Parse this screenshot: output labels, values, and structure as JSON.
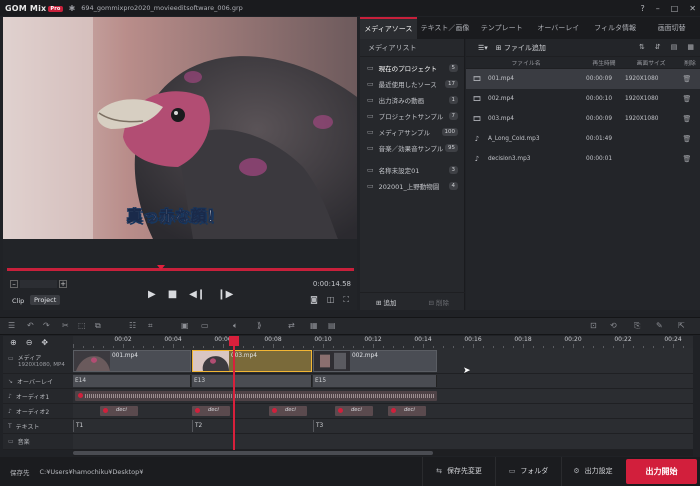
{
  "app": {
    "logo": "GOM Mix",
    "logo_badge": "Pro",
    "filename": "694_gommixpro2020_movieeditsoftware_006.grp",
    "window_controls": [
      "?",
      "–",
      "□",
      "✕"
    ]
  },
  "preview": {
    "caption": "真っ赤な顔！",
    "time": "0:00:14.58",
    "tabs": [
      "Clip",
      "Project"
    ]
  },
  "right_tabs": [
    "メディアソース",
    "テキスト／画像",
    "テンプレート",
    "オーバーレイ",
    "フィルタ情報",
    "画面切替"
  ],
  "media_list": {
    "title": "メディアリスト",
    "folders": [
      {
        "label": "現在のプロジェクト",
        "count": "5"
      },
      {
        "label": "最近使用したソース",
        "count": "17"
      },
      {
        "label": "出力済みの動画",
        "count": "1"
      },
      {
        "label": "プロジェクトサンプル",
        "count": "7"
      },
      {
        "label": "メディアサンプル",
        "count": "100"
      },
      {
        "label": "音楽／効果音サンプル",
        "count": "95"
      }
    ],
    "user_folders": [
      {
        "label": "名称未設定01",
        "count": "3"
      },
      {
        "label": "202001_上野動物園",
        "count": "4"
      }
    ],
    "add_label": "追加",
    "delete_label": "削除"
  },
  "file_list": {
    "add_file": "ファイル追加",
    "columns": {
      "name": "ファイル名",
      "duration": "再生時間",
      "size": "画面サイズ",
      "delete": "削除"
    },
    "rows": [
      {
        "name": "001.mp4",
        "duration": "00:00:09",
        "size": "1920X1080"
      },
      {
        "name": "002.mp4",
        "duration": "00:00:10",
        "size": "1920X1080"
      },
      {
        "name": "003.mp4",
        "duration": "00:00:09",
        "size": "1920X1080"
      },
      {
        "name": "A_Long_Cold.mp3",
        "duration": "00:01:49",
        "size": ""
      },
      {
        "name": "decision3.mp3",
        "duration": "00:00:01",
        "size": ""
      }
    ]
  },
  "timeline": {
    "ticks": [
      "00:02",
      "00:04",
      "00:06",
      "00:08",
      "00:10",
      "00:12",
      "00:14",
      "00:16",
      "00:18",
      "00:20",
      "00:22",
      "00:24"
    ],
    "tracks": {
      "media": "メディア",
      "media_sub": "1920X1080, MP4",
      "overlay": "オーバーレイ",
      "audio1": "オーディオ1",
      "audio2": "オーディオ2",
      "text": "テキスト",
      "music": "音楽"
    },
    "clips": [
      "001.mp4",
      "003.mp4",
      "002.mp4"
    ],
    "overlays": [
      "E14",
      "E13",
      "E15"
    ],
    "audio2_clips": [
      "deci",
      "deci",
      "deci",
      "deci",
      "deci"
    ],
    "texts": [
      "T1",
      "T2",
      "T3"
    ]
  },
  "footer": {
    "save_label": "保存先",
    "save_path": "C:¥Users¥hamochiku¥Desktop¥",
    "change_dest": "保存先変更",
    "folder": "フォルダ",
    "output_settings": "出力設定",
    "export": "出力開始"
  },
  "colors": {
    "accent": "#d21f3c",
    "selected_clip": "#f2b634"
  }
}
